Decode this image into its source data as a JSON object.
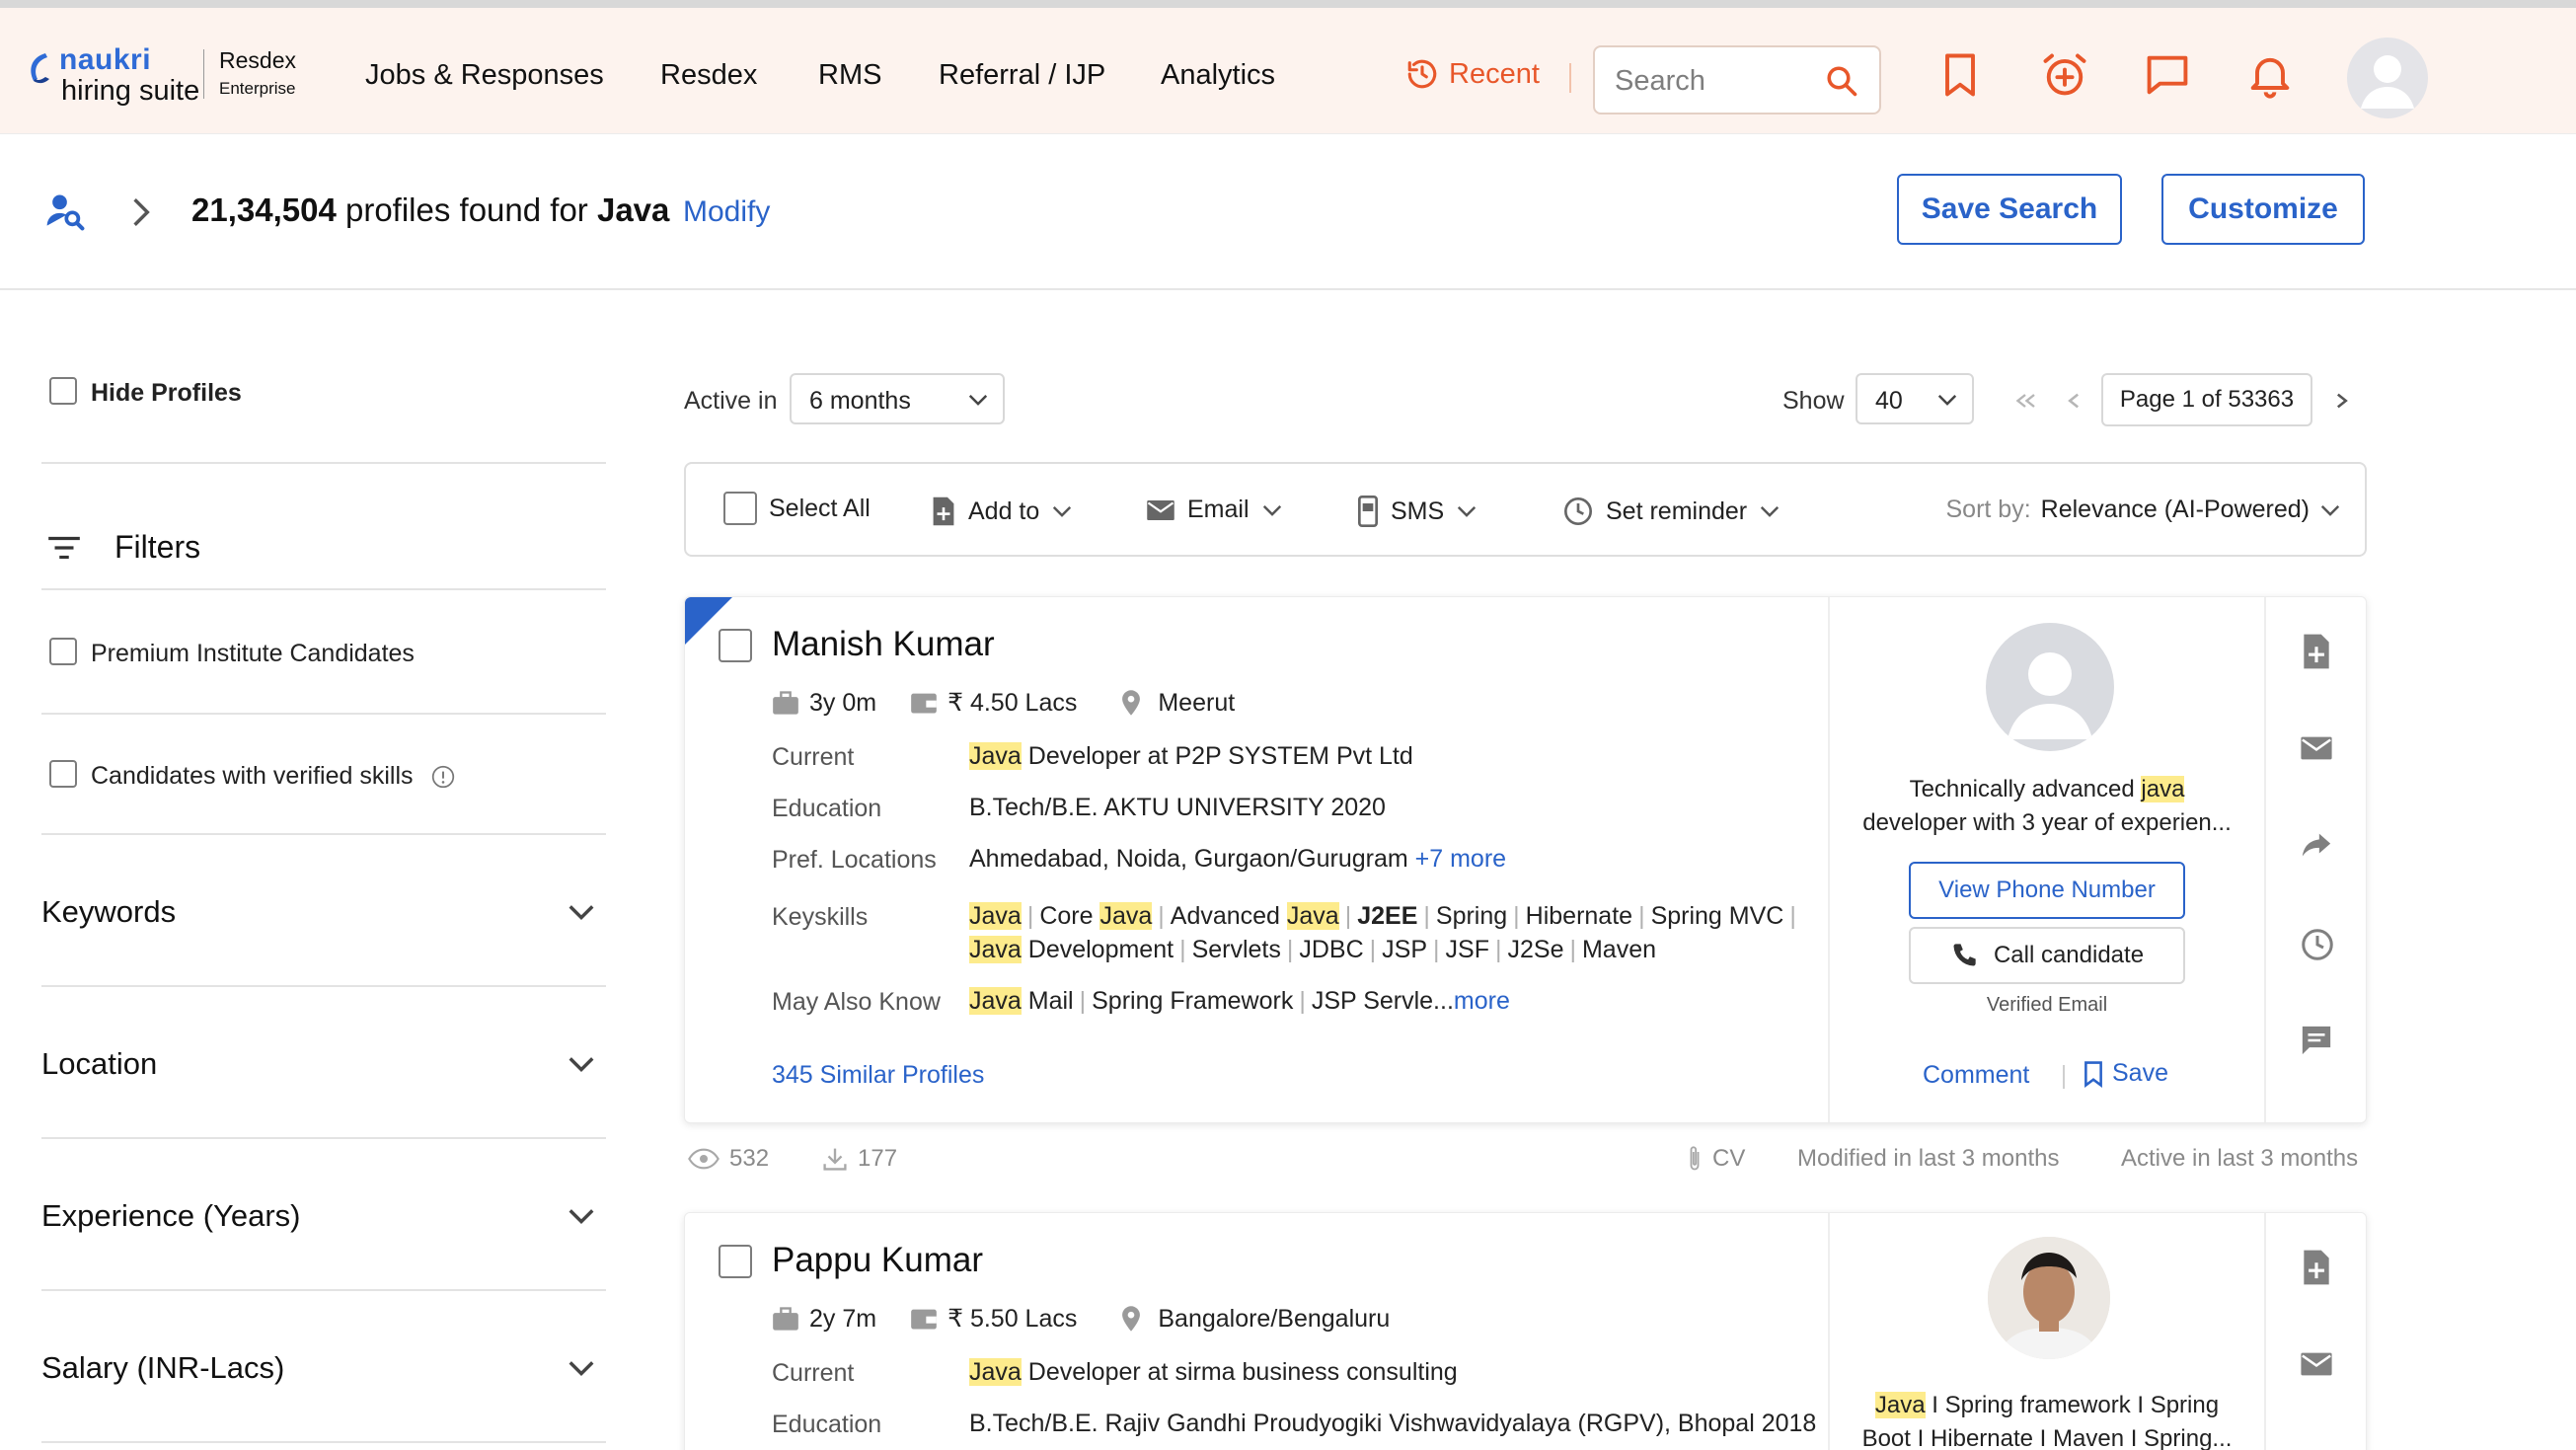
{
  "header": {
    "logo_brand": "naukri",
    "logo_suite": "hiring suite",
    "logo_product": "Resdex",
    "logo_edition": "Enterprise",
    "nav": [
      "Jobs & Responses",
      "Resdex",
      "RMS",
      "Referral / IJP",
      "Analytics"
    ],
    "active_nav": "Resdex",
    "recent_label": "Recent",
    "search_placeholder": "Search",
    "accent_color": "#ef6c3a"
  },
  "results": {
    "count": "21,34,504",
    "text_mid": "profiles found for",
    "query": "Java",
    "modify_label": "Modify",
    "save_search_label": "Save Search",
    "customize_label": "Customize"
  },
  "sidebar": {
    "hide_profiles_label": "Hide Profiles",
    "filters_label": "Filters",
    "premium_label": "Premium Institute Candidates",
    "verified_label": "Candidates with verified skills",
    "sections": [
      "Keywords",
      "Location",
      "Experience (Years)",
      "Salary (INR-Lacs)"
    ]
  },
  "controls": {
    "active_in_label": "Active in",
    "active_in_value": "6 months",
    "show_label": "Show",
    "show_value": "40",
    "page_label": "Page 1 of 53363"
  },
  "toolbar": {
    "select_all": "Select All",
    "add_to": "Add to",
    "email": "Email",
    "sms": "SMS",
    "set_reminder": "Set reminder",
    "sort_by_label": "Sort by:",
    "sort_by_value": "Relevance (AI-Powered)"
  },
  "labels": {
    "current": "Current",
    "education": "Education",
    "pref_locations": "Pref. Locations",
    "keyskills": "Keyskills",
    "may_also_know": "May Also Know",
    "view_phone": "View Phone Number",
    "call_candidate": "Call candidate",
    "verified_email": "Verified Email",
    "comment": "Comment",
    "save": "Save"
  },
  "candidates": [
    {
      "name": "Manish Kumar",
      "experience": "3y 0m",
      "salary": "₹ 4.50 Lacs",
      "location": "Meerut",
      "current_hl": "Java",
      "current_rest": " Developer at P2P SYSTEM Pvt Ltd",
      "education": "B.Tech/B.E. AKTU UNIVERSITY 2020",
      "pref_locations": "Ahmedabad, Noida, Gurgaon/Gurugram",
      "pref_more": "+7 more",
      "keyskills_line1": [
        "Java",
        "Core Java",
        "Advanced Java",
        "J2EE",
        "Spring",
        "Hibernate",
        "Spring MVC"
      ],
      "keyskills_line2": [
        "Java Development",
        "Servlets",
        "JDBC",
        "JSP",
        "JSF",
        "J2Se",
        "Maven"
      ],
      "may_also_know": [
        "Java Mail",
        "Spring Framework",
        "JSP Servle..."
      ],
      "may_also_more": "more",
      "similar": "345 Similar Profiles",
      "summary_pre": "Technically advanced ",
      "summary_hl": "java",
      "summary_post": "developer with 3 year of experien...",
      "views": "532",
      "downloads": "177",
      "cv": "CV",
      "modified": "Modified in last 3 months",
      "active": "Active in last 3 months"
    },
    {
      "name": "Pappu Kumar",
      "experience": "2y 7m",
      "salary": "₹ 5.50 Lacs",
      "location": "Bangalore/Bengaluru",
      "current_hl": "Java",
      "current_rest": " Developer at sirma business consulting",
      "education": "B.Tech/B.E. Rajiv Gandhi Proudyogiki Vishwavidyalaya (RGPV), Bhopal 2018",
      "summary_hl": "Java",
      "summary_line1": " I Spring framework I Spring",
      "summary_line2": "Boot I Hibernate I Maven I Spring..."
    }
  ]
}
